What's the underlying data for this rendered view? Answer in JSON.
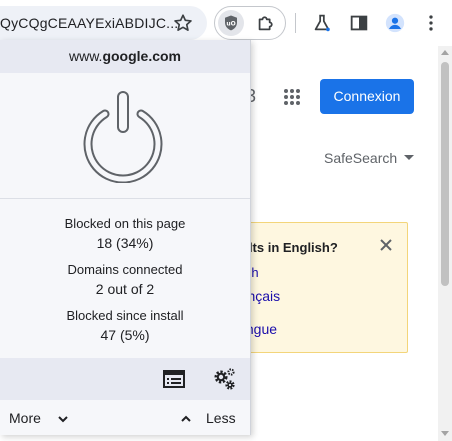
{
  "browser": {
    "url_fragment": "QyCQgCEAAYExiABDIJC...",
    "icons": {
      "bookmark": "star-icon",
      "ublock": "ublock-origin-icon",
      "extensions": "puzzle-icon",
      "labs": "flask-icon",
      "side_panel": "side-panel-icon",
      "profile": "profile-icon",
      "menu": "kebab-menu-icon"
    },
    "accent_color": "#1a73e8"
  },
  "google_page": {
    "sign_in_label": "Connexion",
    "safesearch_label": "SafeSearch",
    "apps_icon": "apps-grid-icon",
    "notice": {
      "title": "ults in English?",
      "link_1": "ish",
      "link_2": "rançais",
      "link_3": "langue",
      "close_icon": "close-icon"
    }
  },
  "popup": {
    "hostname_prefix": "www.",
    "hostname_domain": "google.com",
    "power_icon": "power-icon",
    "stats": [
      {
        "label": "Blocked on this page",
        "value": "18 (34%)"
      },
      {
        "label": "Domains connected",
        "value": "2 out of 2"
      },
      {
        "label": "Blocked since install",
        "value": "47 (5%)"
      }
    ],
    "tools": {
      "logger_icon": "logger-list-icon",
      "dashboard_icon": "gears-icon"
    },
    "more_label": "More",
    "less_label": "Less"
  }
}
